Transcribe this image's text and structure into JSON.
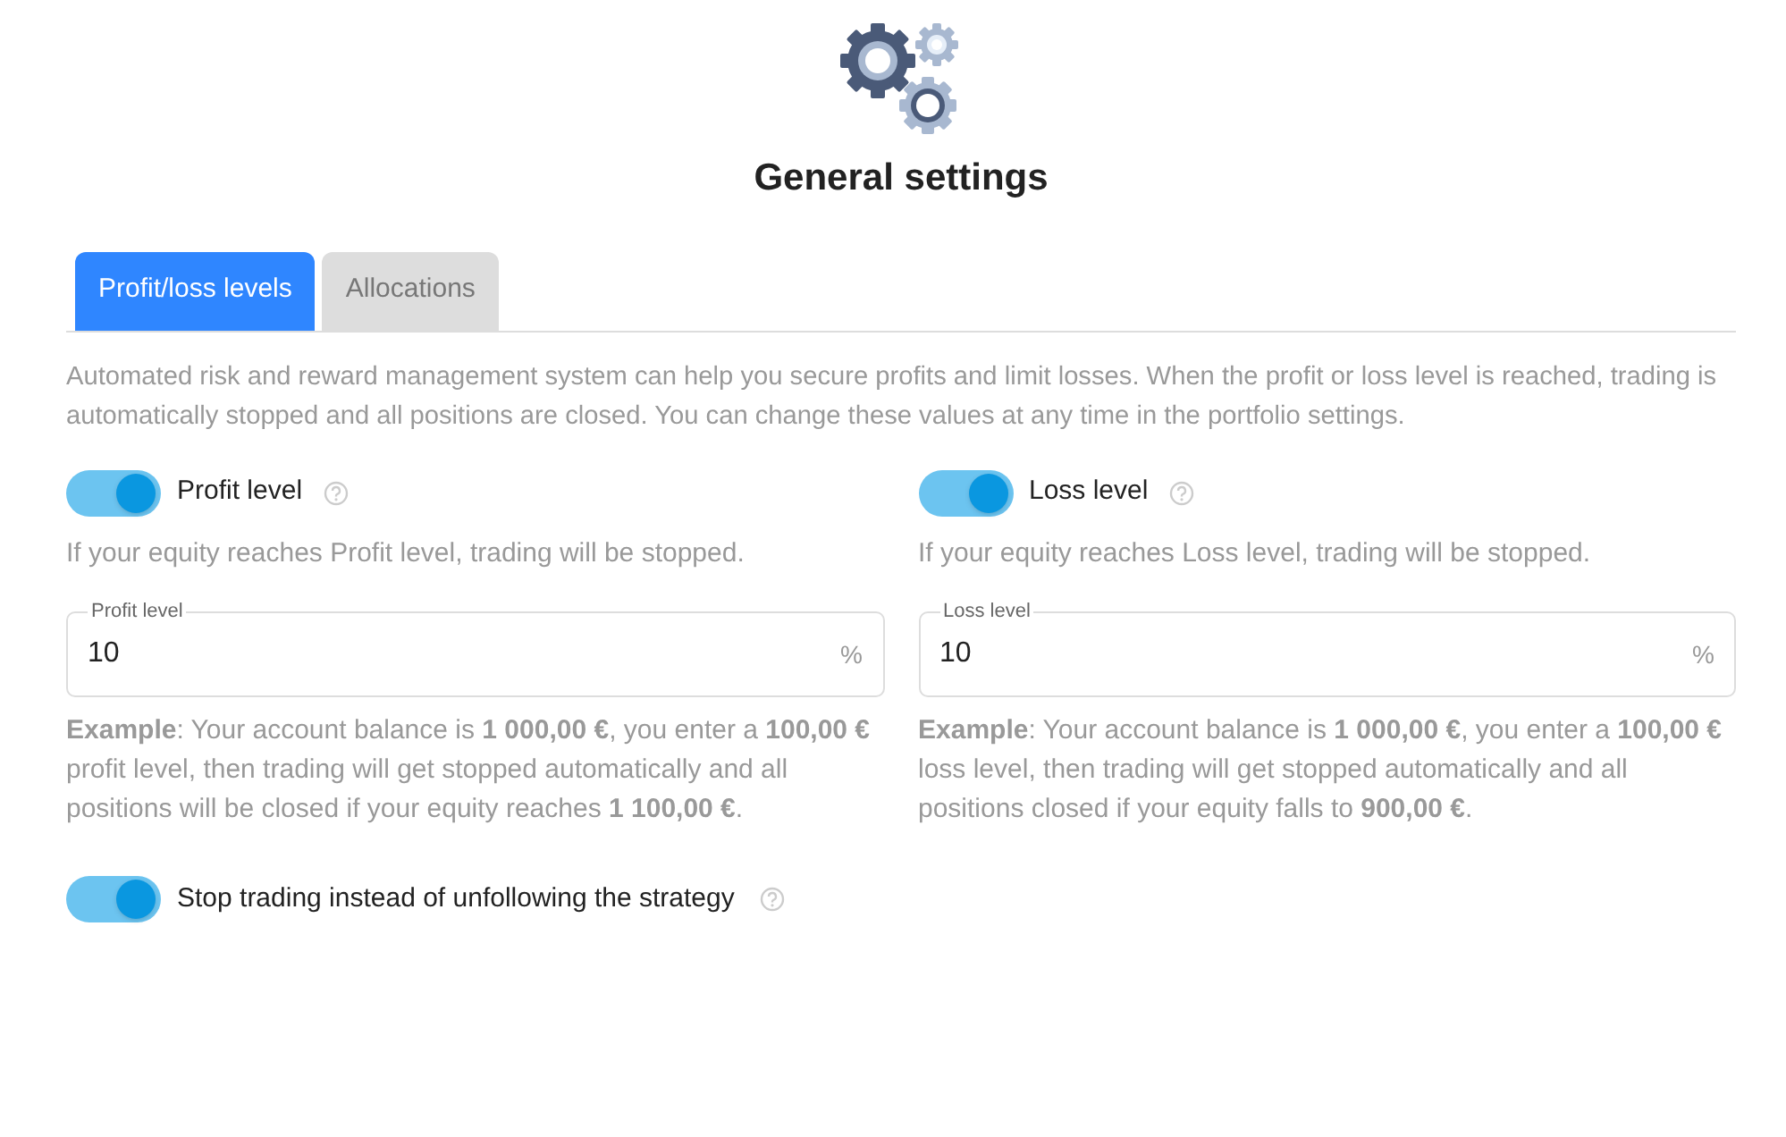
{
  "header": {
    "title": "General settings"
  },
  "tabs": [
    {
      "label": "Profit/loss levels",
      "selected": true
    },
    {
      "label": "Allocations",
      "selected": false
    }
  ],
  "intro": "Automated risk and reward management system can help you secure profits and limit losses. When the profit or loss level is reached, trading is automatically stopped and all positions are closed. You can change these values at any time in the portfolio settings.",
  "levels": [
    {
      "toggle_label": "Profit level",
      "on": true,
      "hint": "If your equity reaches Profit level, trading will be stopped.",
      "field_label": "Profit level",
      "value": "10",
      "unit": "%",
      "example": "**Example**: Your account balance is **1 000,00 €**, you enter a **100,00 €** profit level, then trading will get stopped automatically and all positions will be closed if your equity reaches **1 100,00 €**."
    },
    {
      "toggle_label": "Loss level",
      "on": true,
      "hint": "If your equity reaches Loss level, trading will be stopped.",
      "field_label": "Loss level",
      "value": "10",
      "unit": "%",
      "example": "**Example**: Your account balance is **1 000,00 €**, you enter a **100,00 €** loss level, then trading will get stopped automatically and all positions closed if your equity falls to **900,00 €**."
    }
  ],
  "stop_option": {
    "label": "Stop trading instead of unfollowing the strategy",
    "on": true
  }
}
